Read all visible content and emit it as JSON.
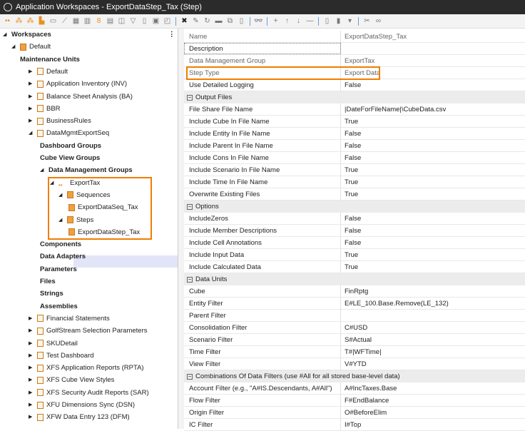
{
  "title": "Application Workspaces - ExportDataStep_Tax (Step)",
  "tree": [
    {
      "label": "Workspaces",
      "level": 0,
      "bold": true,
      "arrow": "◢"
    },
    {
      "label": "Default",
      "level": 1,
      "arrow": "◢"
    },
    {
      "label": "Maintenance Units",
      "level": 2,
      "bold": true,
      "arrow": ""
    },
    {
      "label": "Default",
      "level": 3,
      "arrow": "▶"
    },
    {
      "label": "Application Inventory (INV)",
      "level": 3,
      "arrow": "▶"
    },
    {
      "label": "Balance Sheet Analysis (BA)",
      "level": 3,
      "arrow": "▶"
    },
    {
      "label": "BBR",
      "level": 3,
      "arrow": "▶"
    },
    {
      "label": "BusinessRules",
      "level": 3,
      "arrow": "▶"
    },
    {
      "label": "DataMgmtExportSeq",
      "level": 3,
      "arrow": "◢"
    },
    {
      "label": "Dashboard Groups",
      "level": 4,
      "bold": true,
      "arrow": ""
    },
    {
      "label": "Cube View Groups",
      "level": 4,
      "bold": true,
      "arrow": ""
    },
    {
      "label": "Data Management Groups",
      "level": 4,
      "bold": true,
      "arrow": "◢"
    },
    {
      "label": "ExportTax",
      "level": 5,
      "arrow": "◢"
    },
    {
      "label": "Sequences",
      "level": 6,
      "arrow": "◢"
    },
    {
      "label": "ExportDataSeq_Tax",
      "level": 7,
      "arrow": ""
    },
    {
      "label": "Steps",
      "level": 6,
      "arrow": "◢"
    },
    {
      "label": "ExportDataStep_Tax",
      "level": 7,
      "arrow": ""
    },
    {
      "label": "Components",
      "level": 4,
      "bold": true,
      "arrow": ""
    },
    {
      "label": "Data Adapters",
      "level": 4,
      "bold": true,
      "arrow": ""
    },
    {
      "label": "Parameters",
      "level": 4,
      "bold": true,
      "arrow": ""
    },
    {
      "label": "Files",
      "level": 4,
      "bold": true,
      "arrow": ""
    },
    {
      "label": "Strings",
      "level": 4,
      "bold": true,
      "arrow": ""
    },
    {
      "label": "Assemblies",
      "level": 4,
      "bold": true,
      "arrow": ""
    },
    {
      "label": "Financial Statements",
      "level": 3,
      "arrow": "▶"
    },
    {
      "label": "GolfStream Selection Parameters",
      "level": 3,
      "arrow": "▶"
    },
    {
      "label": "SKUDetail",
      "level": 3,
      "arrow": "▶"
    },
    {
      "label": "Test Dashboard",
      "level": 3,
      "arrow": "▶"
    },
    {
      "label": "XFS Application Reports (RPTA)",
      "level": 3,
      "arrow": "▶"
    },
    {
      "label": "XFS Cube View Styles",
      "level": 3,
      "arrow": "▶"
    },
    {
      "label": "XFS Security Audit Reports (SAR)",
      "level": 3,
      "arrow": "▶"
    },
    {
      "label": "XFU Dimensions Sync (DSN)",
      "level": 3,
      "arrow": "▶"
    },
    {
      "label": "XFW Data Entry 123 (DFM)",
      "level": 3,
      "arrow": "▶"
    }
  ],
  "grid": [
    {
      "n": "Name",
      "v": "ExportDataStep_Tax",
      "ro": true
    },
    {
      "n": "Description",
      "v": ""
    },
    {
      "n": "Data Management Group",
      "v": "ExportTax",
      "ro": true
    },
    {
      "n": "Step Type",
      "v": "Export Data",
      "ro": true
    },
    {
      "n": "Use Detailed Logging",
      "v": "False"
    },
    {
      "cat": "Output Files"
    },
    {
      "n": "File Share File Name",
      "v": "|DateForFileName|\\CubeData.csv"
    },
    {
      "n": "Include Cube In File Name",
      "v": "True"
    },
    {
      "n": "Include Entity In File Name",
      "v": "False"
    },
    {
      "n": "Include Parent In File Name",
      "v": "False"
    },
    {
      "n": "Include Cons In File Name",
      "v": "False"
    },
    {
      "n": "Include Scenario In File Name",
      "v": "True"
    },
    {
      "n": "Include Time In File Name",
      "v": "True"
    },
    {
      "n": "Overwrite Existing Files",
      "v": "True"
    },
    {
      "cat": "Options"
    },
    {
      "n": "IncludeZeros",
      "v": "False"
    },
    {
      "n": "Include Member Descriptions",
      "v": "False"
    },
    {
      "n": "Include Cell Annotations",
      "v": "False"
    },
    {
      "n": "Include Input Data",
      "v": "True"
    },
    {
      "n": "Include Calculated Data",
      "v": "True"
    },
    {
      "cat": "Data Units"
    },
    {
      "n": "Cube",
      "v": "FinRptg"
    },
    {
      "n": "Entity Filter",
      "v": "E#LE_100.Base.Remove(LE_132)"
    },
    {
      "n": "Parent Filter",
      "v": ""
    },
    {
      "n": "Consolidation Filter",
      "v": "C#USD"
    },
    {
      "n": "Scenario Filter",
      "v": "S#Actual"
    },
    {
      "n": "Time Filter",
      "v": "T#|WFTime|"
    },
    {
      "n": "View Filter",
      "v": "V#YTD"
    },
    {
      "cat": "Combinations Of Data Filters (use #All for all stored base-level data)"
    },
    {
      "n": "Account Filter (e.g., \"A#IS.Descendants, A#All\")",
      "v": "A#IncTaxes.Base"
    },
    {
      "n": "Flow Filter",
      "v": "F#EndBalance"
    },
    {
      "n": "Origin Filter",
      "v": "O#BeforeElim"
    },
    {
      "n": "IC Filter",
      "v": "I#Top"
    }
  ],
  "toolbar_icons": [
    "dots",
    "tree",
    "tree-add",
    "workspace",
    "dashboard",
    "chart",
    "cube",
    "seq",
    "step",
    "table",
    "split",
    "filter",
    "doc",
    "doc2",
    "copy",
    "|",
    "delete",
    "edit",
    "refresh",
    "save",
    "link",
    "clipboard",
    "|",
    "search",
    "|",
    "add",
    "up",
    "down",
    "remove",
    "|",
    "new",
    "run",
    "dropdown",
    "|",
    "scissors",
    "glasses"
  ]
}
